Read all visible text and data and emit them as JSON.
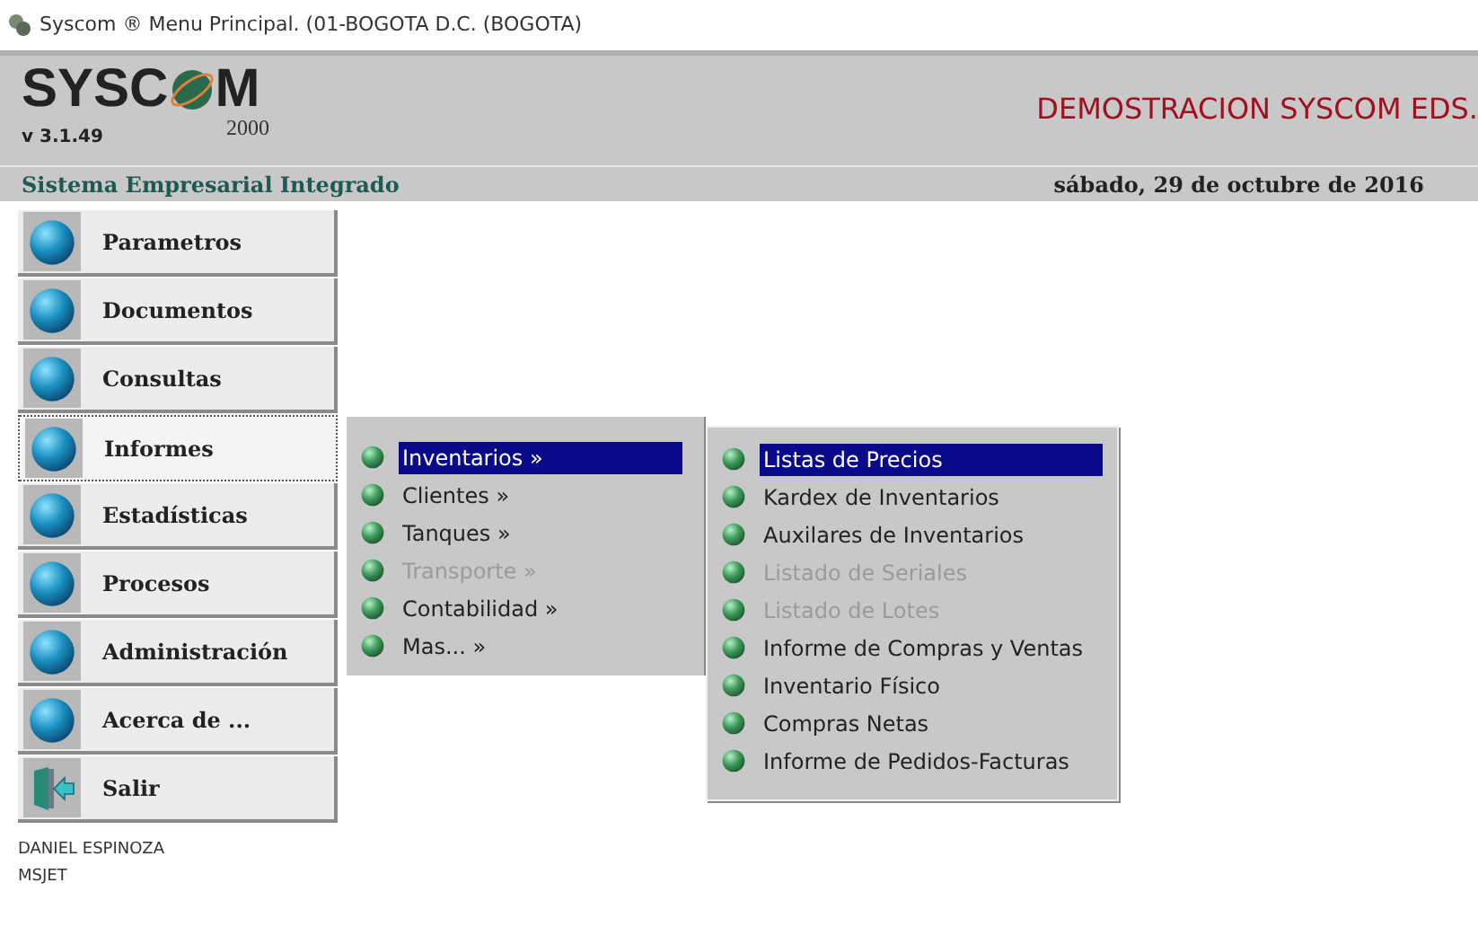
{
  "window": {
    "title": "Syscom ® Menu Principal.  (01-BOGOTA D.C. (BOGOTA)"
  },
  "header": {
    "logo_left": "SYSC",
    "logo_right": "M",
    "logo_year": "2000",
    "version": "v 3.1.49",
    "company": "DEMOSTRACION SYSCOM EDS.",
    "subtitle": "Sistema Empresarial Integrado",
    "date": "sábado, 29 de octubre de 2016"
  },
  "main_menu": [
    {
      "label": "Parametros",
      "kind": "globe",
      "selected": false
    },
    {
      "label": "Documentos",
      "kind": "globe",
      "selected": false
    },
    {
      "label": "Consultas",
      "kind": "globe",
      "selected": false
    },
    {
      "label": "Informes",
      "kind": "globe",
      "selected": true
    },
    {
      "label": "Estadísticas",
      "kind": "globe",
      "selected": false
    },
    {
      "label": "Procesos",
      "kind": "globe",
      "selected": false
    },
    {
      "label": "Administración",
      "kind": "globe",
      "selected": false
    },
    {
      "label": "Acerca de ...",
      "kind": "globe",
      "selected": false
    },
    {
      "label": "Salir",
      "kind": "exit",
      "selected": false
    }
  ],
  "submenu": [
    {
      "label": "Inventarios »",
      "selected": true,
      "disabled": false
    },
    {
      "label": "Clientes »",
      "selected": false,
      "disabled": false
    },
    {
      "label": "Tanques »",
      "selected": false,
      "disabled": false
    },
    {
      "label": "Transporte »",
      "selected": false,
      "disabled": true
    },
    {
      "label": "Contabilidad »",
      "selected": false,
      "disabled": false
    },
    {
      "label": "Mas... »",
      "selected": false,
      "disabled": false
    }
  ],
  "inventory_menu": [
    {
      "label": "Listas de Precios",
      "selected": true,
      "disabled": false
    },
    {
      "label": "Kardex de Inventarios",
      "selected": false,
      "disabled": false
    },
    {
      "label": "Auxilares de Inventarios",
      "selected": false,
      "disabled": false
    },
    {
      "label": "Listado de Seriales",
      "selected": false,
      "disabled": true
    },
    {
      "label": "Listado de Lotes",
      "selected": false,
      "disabled": true
    },
    {
      "label": "Informe de Compras y Ventas",
      "selected": false,
      "disabled": false
    },
    {
      "label": "Inventario Físico",
      "selected": false,
      "disabled": false
    },
    {
      "label": "Compras Netas",
      "selected": false,
      "disabled": false
    },
    {
      "label": "Informe de Pedidos-Facturas",
      "selected": false,
      "disabled": false
    }
  ],
  "status": {
    "user": "DANIEL ESPINOZA",
    "database": "MSJET"
  }
}
